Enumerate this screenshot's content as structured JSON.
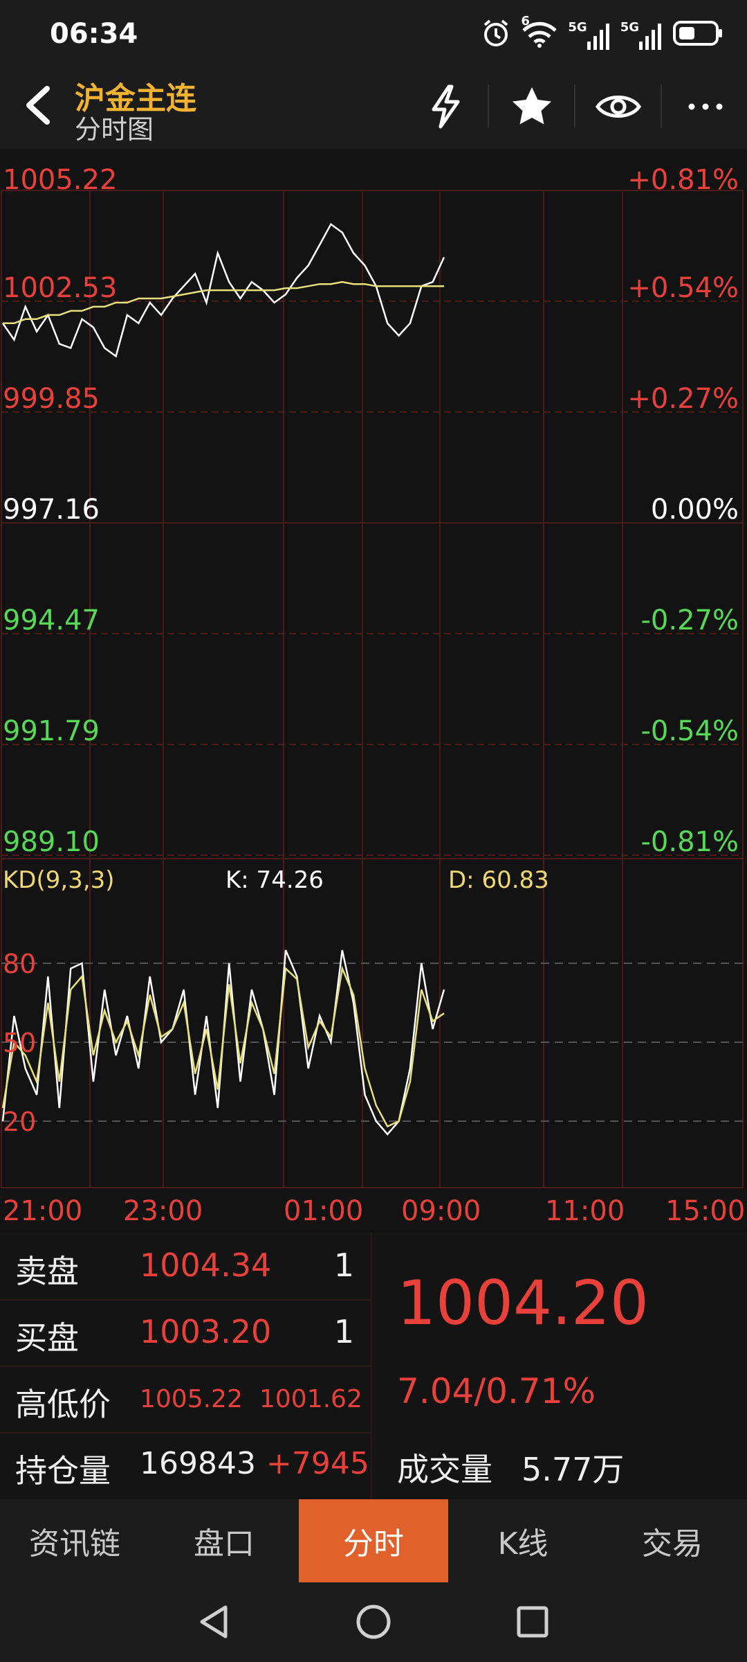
{
  "status_bar": {
    "time": "06:34",
    "net1": "5G",
    "net2": "5G",
    "wifi_sup": "6"
  },
  "header": {
    "title": "沪金主连",
    "subtitle": "分时图"
  },
  "price_axis": {
    "left": [
      "1005.22",
      "1002.53",
      "999.85",
      "997.16",
      "994.47",
      "991.79",
      "989.10"
    ],
    "right": [
      "+0.81%",
      "+0.54%",
      "+0.27%",
      "0.00%",
      "-0.27%",
      "-0.54%",
      "-0.81%"
    ]
  },
  "kd": {
    "label": "KD(9,3,3)",
    "k": "K: 74.26",
    "d": "D: 60.83",
    "levels": [
      "80",
      "50",
      "20"
    ]
  },
  "time_axis": [
    "21:00",
    "23:00",
    "01:00",
    "09:00",
    "11:00",
    "15:00"
  ],
  "info": {
    "sell_label": "卖盘",
    "sell_price": "1004.34",
    "sell_qty": "1",
    "buy_label": "买盘",
    "buy_price": "1003.20",
    "buy_qty": "1",
    "hl_label": "高低价",
    "high": "1005.22",
    "low": "1001.62",
    "oi_label": "持仓量",
    "oi": "169843",
    "oi_change": "+7945",
    "last_price": "1004.20",
    "change": "7.04/0.71%",
    "volume_label": "成交量",
    "volume": "5.77万"
  },
  "tabs": [
    "资讯链",
    "盘口",
    "分时",
    "K线",
    "交易"
  ],
  "active_tab": 2,
  "colors": {
    "up": "#e8403a",
    "down": "#57d957",
    "accent": "#f2b232",
    "active_tab": "#e0612b",
    "avg_line": "#e8e07a"
  },
  "chart_data": {
    "type": "line",
    "title": "",
    "ylim": [
      989.1,
      1005.22
    ],
    "prev_close": 997.16,
    "x": [
      "21:00",
      "23:00",
      "01:00",
      "09:00",
      "11:00",
      "15:00"
    ],
    "series": [
      {
        "values": [
          1002.0,
          1001.6,
          1002.4,
          1001.8,
          1002.2,
          1001.5,
          1001.4,
          1002.1,
          1001.9,
          1001.4,
          1001.2,
          1002.2,
          1002.0,
          1002.5,
          1002.2,
          1002.6,
          1002.9,
          1003.2,
          1002.5,
          1003.7,
          1003.0,
          1002.6,
          1003.0,
          1002.8,
          1002.5,
          1002.7,
          1003.1,
          1003.4,
          1003.9,
          1004.4,
          1004.2,
          1003.7,
          1003.4,
          1002.9,
          1002.0,
          1001.7,
          1002.0,
          1002.9,
          1003.0,
          1003.6
        ]
      },
      {
        "values": [
          1002.0,
          1002.0,
          1002.1,
          1002.1,
          1002.2,
          1002.2,
          1002.3,
          1002.3,
          1002.4,
          1002.4,
          1002.5,
          1002.5,
          1002.6,
          1002.6,
          1002.6,
          1002.65,
          1002.7,
          1002.75,
          1002.8,
          1002.8,
          1002.8,
          1002.8,
          1002.8,
          1002.8,
          1002.8,
          1002.85,
          1002.85,
          1002.9,
          1002.95,
          1002.95,
          1003.0,
          1002.95,
          1002.95,
          1002.9,
          1002.9,
          1002.9,
          1002.9,
          1002.9,
          1002.9,
          1002.9
        ]
      }
    ],
    "kd_series": [
      {
        "name": "K",
        "values": [
          20,
          60,
          40,
          30,
          75,
          25,
          78,
          80,
          35,
          70,
          45,
          60,
          40,
          75,
          50,
          55,
          70,
          30,
          60,
          25,
          80,
          35,
          70,
          55,
          30,
          85,
          75,
          40,
          60,
          50,
          85,
          65,
          30,
          20,
          15,
          20,
          40,
          80,
          55,
          70
        ]
      },
      {
        "name": "D",
        "values": [
          25,
          50,
          45,
          35,
          65,
          35,
          70,
          75,
          45,
          62,
          50,
          58,
          45,
          68,
          52,
          55,
          65,
          38,
          55,
          32,
          72,
          42,
          65,
          55,
          38,
          78,
          74,
          48,
          58,
          52,
          78,
          68,
          40,
          26,
          18,
          20,
          35,
          70,
          58,
          61
        ]
      }
    ]
  }
}
